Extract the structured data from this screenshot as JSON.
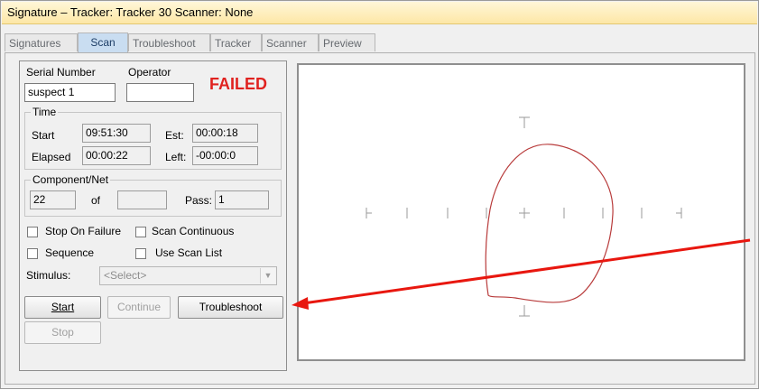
{
  "window": {
    "title": "Signature – Tracker: Tracker 30  Scanner: None"
  },
  "tabs": [
    "Signatures",
    "Scan",
    "Troubleshoot",
    "Tracker",
    "Scanner",
    "Preview"
  ],
  "form": {
    "serial_label": "Serial Number",
    "operator_label": "Operator",
    "serial_value": "suspect 1",
    "operator_value": "",
    "status": "FAILED",
    "time": {
      "caption": "Time",
      "start_label": "Start",
      "start_value": "09:51:30",
      "est_label": "Est:",
      "est_value": "00:00:18",
      "elapsed_label": "Elapsed",
      "elapsed_value": "00:00:22",
      "left_label": "Left:",
      "left_value": "-00:00:0"
    },
    "component": {
      "caption": "Component/Net",
      "current": "22",
      "of_label": "of",
      "total": "",
      "pass_label": "Pass:",
      "pass_value": "1"
    },
    "options": {
      "stop_on_failure": "Stop On Failure",
      "scan_continuous": "Scan Continuous",
      "sequence": "Sequence",
      "use_scan_list": "Use Scan List"
    },
    "stimulus_label": "Stimulus:",
    "stimulus_value": "<Select>",
    "buttons": {
      "start": "Start",
      "continue": "Continue",
      "troubleshoot": "Troubleshoot",
      "stop": "Stop"
    }
  },
  "colors": {
    "status_red": "#e0221f",
    "trace": "#b83b3b",
    "arrow": "#e8170f",
    "title_bg": "#fde7a6",
    "active_tab": "#c9ddf1"
  }
}
